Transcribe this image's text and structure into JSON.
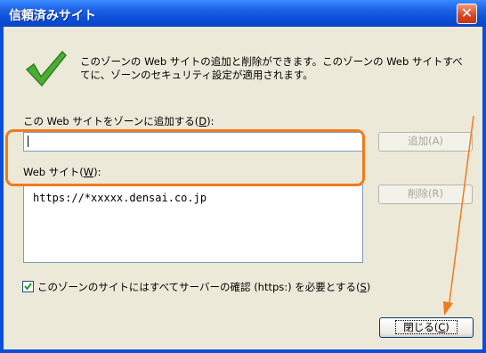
{
  "window": {
    "title": "信頼済みサイト",
    "close_glyph": "✕"
  },
  "description": "このゾーンの Web サイトの追加と削除ができます。このゾーンの Web サイトすべてに、ゾーンのセキュリティ設定が適用されます。",
  "add_section": {
    "label": "この Web サイトをゾーンに追加する(",
    "accelerator": "D",
    "label_end": "):",
    "input_value": "",
    "add_button": "追加(A)"
  },
  "websites": {
    "label": "Web サイト(",
    "accelerator": "W",
    "label_end": "):",
    "items": [
      "https://*xxxxx.densai.co.jp"
    ],
    "remove_button": "削除(R)"
  },
  "https_checkbox": {
    "checked": true,
    "label": "このゾーンのサイトにはすべてサーバーの確認 (https:) を必要とする(",
    "accelerator": "S",
    "label_end": ")"
  },
  "close_button": {
    "label": "閉じる(",
    "accelerator": "C",
    "label_end": ")"
  },
  "icons": {
    "check": "check-mark-icon",
    "arrow": "annotation-arrow"
  },
  "colors": {
    "highlight": "#ee7b1e",
    "titlebar": "#0b4fd9",
    "check": "#3a9a2a"
  }
}
